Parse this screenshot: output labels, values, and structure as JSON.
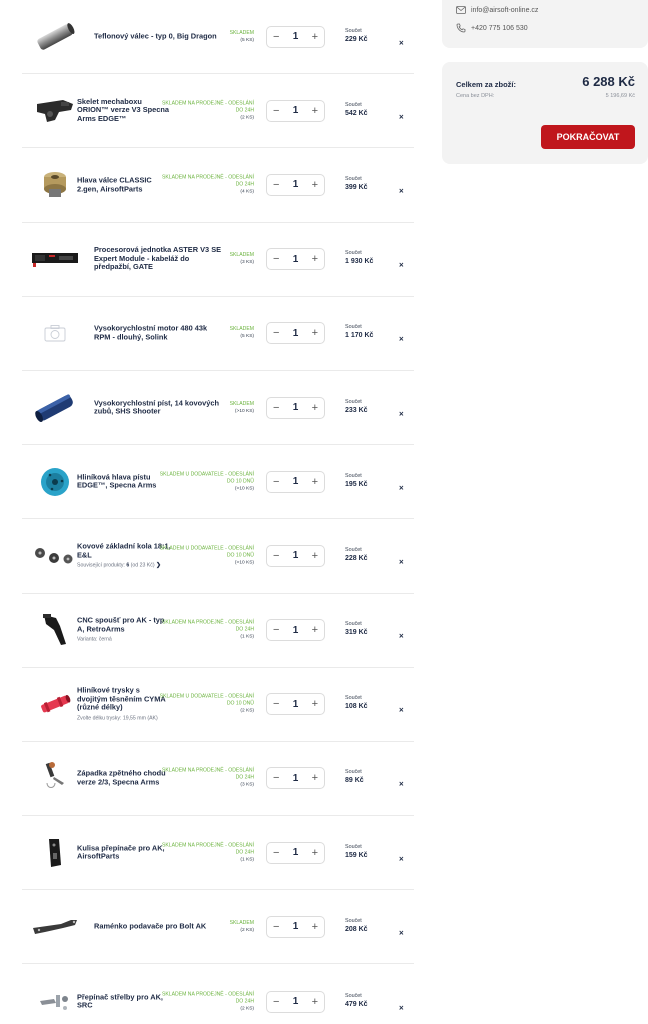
{
  "contact": {
    "email": "info@airsoft-online.cz",
    "phone": "+420 775 106 530"
  },
  "summary": {
    "total_label": "Celkem za zboží:",
    "total_value": "6 288 Kč",
    "net_label": "Cena bez DPH:",
    "net_value": "5 196,69 Kč",
    "continue_label": "POKRAČOVAT"
  },
  "colors": {
    "accent_red": "#c0161c",
    "stock_green": "#6cb33f",
    "text_dark": "#1e2a44",
    "panel_bg": "#f3f3f3"
  },
  "cart_items": [
    {
      "name": "Teflonový válec - typ 0, Big Dragon",
      "sub": "",
      "stock": "SKLADEM",
      "count": "(5 KS)",
      "qty": "1",
      "total_label": "Součet",
      "total": "229 Kč",
      "image": "cylinder-image",
      "icon_indent": true
    },
    {
      "name": "Skelet mechaboxu ORION™ verze V3 Specna Arms EDGE™",
      "sub": "",
      "stock": "SKLADEM NA PRODEJNĚ - ODESLÁNÍ DO 24H",
      "count": "(2 KS)",
      "qty": "1",
      "total_label": "Součet",
      "total": "542 Kč",
      "image": "gearbox-shell-image"
    },
    {
      "name": "Hlava válce CLASSIC 2.gen, AirsoftParts",
      "sub": "",
      "stock": "SKLADEM NA PRODEJNĚ - ODESLÁNÍ DO 24H",
      "count": "(4 KS)",
      "qty": "1",
      "total_label": "Součet",
      "total": "399 Kč",
      "image": "cylinder-head-image"
    },
    {
      "name": "Procesorová jednotka ASTER V3 SE Expert Module - kabeláž do předpažbí, GATE",
      "sub": "",
      "stock": "SKLADEM",
      "count": "(3 KS)",
      "qty": "1",
      "total_label": "Součet",
      "total": "1 930 Kč",
      "image": "processor-unit-image",
      "icon_indent": true
    },
    {
      "name": "Vysokorychlostní motor 480 43k RPM - dlouhý, Solink",
      "sub": "",
      "stock": "SKLADEM",
      "count": "(5 KS)",
      "qty": "1",
      "total_label": "Součet",
      "total": "1 170 Kč",
      "image": "placeholder-camera-icon",
      "icon_indent": true
    },
    {
      "name": "Vysokorychlostní píst, 14 kovových zubů, SHS Shooter",
      "sub": "",
      "stock": "SKLADEM",
      "count": "(>10 KS)",
      "qty": "1",
      "total_label": "Součet",
      "total": "233 Kč",
      "image": "piston-image",
      "icon_indent": true
    },
    {
      "name": "Hliníková hlava pístu EDGE™, Specna Arms",
      "sub": "",
      "stock": "SKLADEM U DODAVATELE - ODESLÁNÍ DO 10 DNŮ",
      "count": "(>10 KS)",
      "qty": "1",
      "total_label": "Součet",
      "total": "195 Kč",
      "image": "piston-head-image"
    },
    {
      "name": "Kovové základní kola 18:1, E&L",
      "sub_prefix": "Související produkty: ",
      "sub_bold": "6",
      "sub": " (od 23 Kč)",
      "has_chevron": true,
      "stock": "SKLADEM U DODAVATELE - ODESLÁNÍ DO 10 DNŮ",
      "count": "(>10 KS)",
      "qty": "1",
      "total_label": "Součet",
      "total": "228 Kč",
      "image": "gears-image"
    },
    {
      "name": "CNC spoušť pro AK - typ A, RetroArms",
      "sub": "Varianta: černá",
      "stock": "SKLADEM NA PRODEJNĚ - ODESLÁNÍ DO 24H",
      "count": "(1 KS)",
      "qty": "1",
      "total_label": "Součet",
      "total": "319 Kč",
      "image": "trigger-image"
    },
    {
      "name": "Hliníkové trysky s dvojitým těsněním CYMA (různé délky)",
      "sub": "Zvolte délku trysky: 19,55 mm (AK)",
      "stock": "SKLADEM U DODAVATELE - ODESLÁNÍ DO 10 DNŮ",
      "count": "(2 KS)",
      "qty": "1",
      "total_label": "Součet",
      "total": "108 Kč",
      "image": "nozzle-image"
    },
    {
      "name": "Západka zpětného chodu verze 2/3, Specna Arms",
      "sub": "",
      "stock": "SKLADEM NA PRODEJNĚ - ODESLÁNÍ DO 24H",
      "count": "(3 KS)",
      "qty": "1",
      "total_label": "Součet",
      "total": "89 Kč",
      "image": "latch-image"
    },
    {
      "name": "Kulisa přepínače pro AK, AirsoftParts",
      "sub": "",
      "stock": "SKLADEM NA PRODEJNĚ - ODESLÁNÍ DO 24H",
      "count": "(1 KS)",
      "qty": "1",
      "total_label": "Součet",
      "total": "159 Kč",
      "image": "selector-plate-image"
    },
    {
      "name": "Raménko podavače pro Bolt AK",
      "sub": "",
      "stock": "SKLADEM",
      "count": "(2 KS)",
      "qty": "1",
      "total_label": "Součet",
      "total": "208 Kč",
      "image": "feed-arm-image",
      "icon_indent": true
    },
    {
      "name": "Přepínač střelby pro AK, SRC",
      "sub": "",
      "stock": "SKLADEM NA PRODEJNĚ - ODESLÁNÍ DO 24H",
      "count": "(2 KS)",
      "qty": "1",
      "total_label": "Součet",
      "total": "479 Kč",
      "image": "fire-selector-image"
    }
  ]
}
